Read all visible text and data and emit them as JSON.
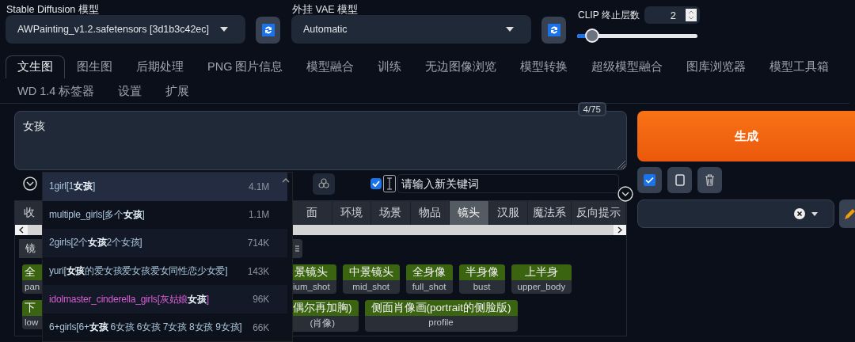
{
  "sd_model": {
    "label": "Stable Diffusion 模型",
    "value": "AWPainting_v1.2.safetensors [3d1b3c42ec]"
  },
  "vae_model": {
    "label": "外挂 VAE 模型",
    "value": "Automatic"
  },
  "clip_skip": {
    "label": "CLIP 终止层数",
    "value": "2",
    "level": 0.09
  },
  "tabs": [
    {
      "label": "文生图",
      "selected": true
    },
    {
      "label": "图生图",
      "selected": false
    },
    {
      "label": "后期处理",
      "selected": false
    },
    {
      "label": "PNG 图片信息",
      "selected": false
    },
    {
      "label": "模型融合",
      "selected": false
    },
    {
      "label": "训练",
      "selected": false
    },
    {
      "label": "无边图像浏览",
      "selected": false
    },
    {
      "label": "模型转换",
      "selected": false
    },
    {
      "label": "超级模型融合",
      "selected": false
    },
    {
      "label": "图库浏览器",
      "selected": false
    },
    {
      "label": "模型工具箱",
      "selected": false
    },
    {
      "label": "WD 1.4 标签器",
      "selected": false
    },
    {
      "label": "设置",
      "selected": false
    },
    {
      "label": "扩展",
      "selected": false
    }
  ],
  "prompt": {
    "value": "女孩",
    "token_count": "4/75"
  },
  "generate_button": "生成",
  "keyword_filter": {
    "checked": true,
    "placeholder": "请输入新关键词"
  },
  "categories_left": [
    {
      "label": "收",
      "selected": false
    }
  ],
  "categories": [
    {
      "label": "面",
      "selected": false
    },
    {
      "label": "环境",
      "selected": false
    },
    {
      "label": "场景",
      "selected": false
    },
    {
      "label": "物品",
      "selected": false
    },
    {
      "label": "镜头",
      "selected": true
    },
    {
      "label": "汉服",
      "selected": false
    },
    {
      "label": "魔法系",
      "selected": false
    },
    {
      "label": "反向提示",
      "selected": false
    }
  ],
  "subtab": "镜",
  "tag_rows": [
    {
      "left": {
        "label": "全",
        "tag": "pan"
      },
      "right": [
        {
          "label": "景镜头",
          "tag": "ium_shot"
        },
        {
          "label": "中景镜头",
          "tag": "mid_shot"
        },
        {
          "label": "全身像",
          "tag": "full_shot"
        },
        {
          "label": "半身像",
          "tag": "bust"
        },
        {
          "label": "上半身",
          "tag": "upper_body"
        }
      ]
    },
    {
      "left": {
        "label": "下",
        "tag": "low"
      },
      "right": [
        {
          "label": "偶尔再加胸)",
          "tag": "(肖像)"
        },
        {
          "label": "侧面肖像画(portrait的侧脸版)",
          "tag": "profile"
        }
      ]
    }
  ],
  "autocomplete": [
    {
      "label": "1girl[1**女孩**]",
      "count": "4.1M",
      "selected": true,
      "color": "#a9c6dd"
    },
    {
      "label": "multiple_girls[多个**女孩**]",
      "count": "1.1M",
      "selected": false,
      "color": "#a9c6dd"
    },
    {
      "label": "2girls[2个**女孩**2个女孩]",
      "count": "714K",
      "selected": false,
      "color": "#a9c6dd"
    },
    {
      "label": "yuri[**女孩**的爱女孩爱女孩爱女同性恋少女爱]",
      "count": "143K",
      "selected": false,
      "color": "#a9c6dd"
    },
    {
      "label": "idolmaster_cinderella_girls[灰姑娘**女孩**]",
      "count": "96K",
      "selected": false,
      "color": "#d95fd6"
    },
    {
      "label": "6+girls[6+**女孩** 6女孩 6女孩 7女孩 8女孩 9女孩]",
      "count": "66K",
      "selected": false,
      "color": "#a9c6dd"
    }
  ]
}
